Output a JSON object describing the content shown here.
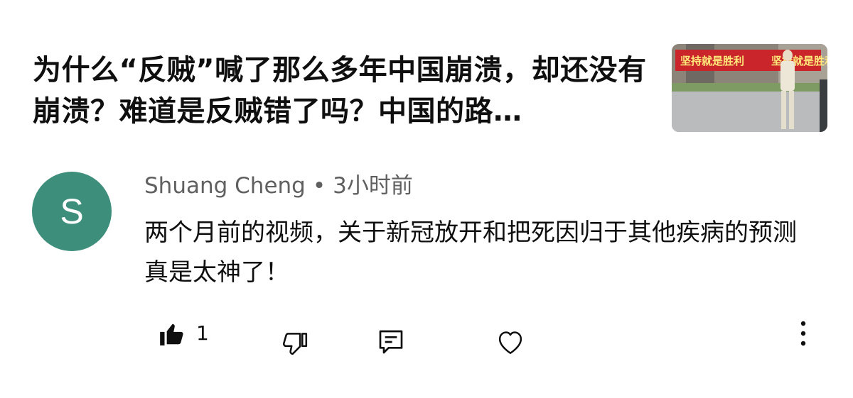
{
  "video": {
    "title": "为什么“反贼”喊了那么多年中国崩溃，却还没有崩溃？难道是反贼错了吗？中国的路…",
    "thumbnail_banner": "坚持就是胜利"
  },
  "comment": {
    "avatar_letter": "S",
    "avatar_color": "#3e8e7c",
    "author": "Shuang Cheng",
    "separator": "•",
    "time": "3小时前",
    "text": "两个月前的视频，关于新冠放开和把死因归于其他疾病的预测真是太神了！",
    "like_count": "1"
  },
  "actions": {
    "like_icon": "thumbs-up-filled-icon",
    "dislike_icon": "thumbs-down-icon",
    "reply_icon": "reply-comment-icon",
    "heart_icon": "heart-icon",
    "more_icon": "more-vertical-icon"
  }
}
